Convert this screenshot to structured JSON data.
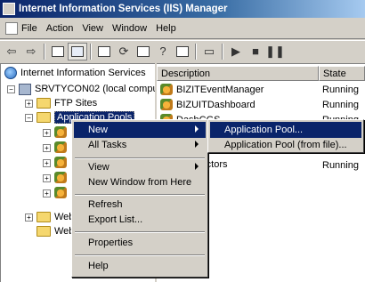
{
  "title": "Internet Information Services (IIS) Manager",
  "menu": [
    {
      "label": "File",
      "ul": "F"
    },
    {
      "label": "Action",
      "ul": "A"
    },
    {
      "label": "View",
      "ul": "V"
    },
    {
      "label": "Window",
      "ul": "W"
    },
    {
      "label": "Help",
      "ul": "H"
    }
  ],
  "toolbar": {
    "icons": [
      "back-icon",
      "forward-icon",
      "up-folder-icon",
      "show-tree-icon",
      "properties-icon",
      "refresh-icon",
      "export-list-icon",
      "help-icon",
      "show-console-icon",
      "computer-icon",
      "play-icon",
      "stop-icon",
      "pause-icon"
    ]
  },
  "tree": {
    "root": "Internet Information Services",
    "server": "SRVTYCON02 (local compu",
    "ftp": "FTP Sites",
    "app_pools": "Application Pools",
    "web1": "Web",
    "web2": "Web"
  },
  "list": {
    "columns": {
      "description": "Description",
      "state": "State"
    },
    "rows": [
      {
        "name": "BIZITEventManager",
        "state": "Running"
      },
      {
        "name": "BIZUITDashboard",
        "state": "Running"
      },
      {
        "name": "DashCGS",
        "state": "Running"
      },
      {
        "name": "",
        "state": ""
      },
      {
        "name": "",
        "state": ""
      },
      {
        "name": "...onnectors",
        "state": "Running"
      }
    ]
  },
  "context_menu": {
    "new": "New",
    "all_tasks": "All Tasks",
    "view": "View",
    "new_window": "New Window from Here",
    "refresh": "Refresh",
    "export_list": "Export List...",
    "properties": "Properties",
    "help": "Help"
  },
  "submenu": {
    "app_pool": "Application Pool...",
    "app_pool_file": "Application Pool (from file)..."
  },
  "colors": {
    "highlight": "#0a246a",
    "chrome": "#d4d0c8"
  }
}
